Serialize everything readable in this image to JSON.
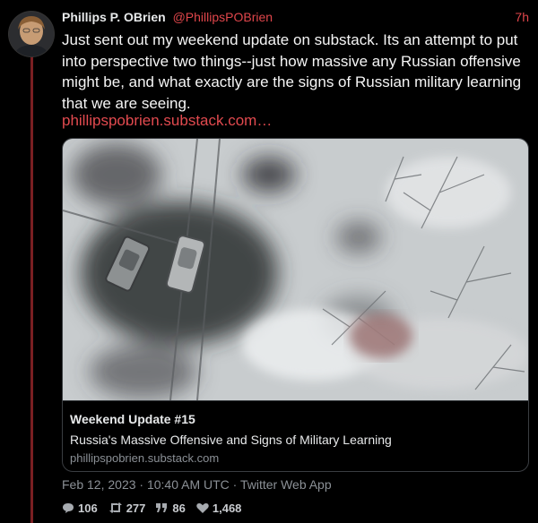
{
  "tweet": {
    "author_name": "Phillips P. OBrien",
    "author_handle": "@PhillipsPOBrien",
    "time_ago": "7h",
    "text": "Just sent out my weekend update on substack. Its an attempt to put into perspective two things--just how massive any Russian offensive might be, and what exactly are the signs of Russian military learning that we are seeing.",
    "link": "phillipspobrien.substack.com…",
    "timestamp": "Feb 12, 2023 · 10:40 AM UTC · Twitter Web App"
  },
  "card": {
    "title": "Weekend Update #15",
    "description": "Russia's Massive Offensive and Signs of Military Learning",
    "domain": "phillipspobrien.substack.com"
  },
  "stats": {
    "replies": "106",
    "retweets": "277",
    "quotes": "86",
    "likes": "1,468"
  },
  "icons": {
    "reply": "comment-icon",
    "retweet": "retweet-icon",
    "quote": "quote-icon",
    "like": "heart-icon"
  },
  "colors": {
    "accent": "#e0464b",
    "thread_line": "#7a1f22",
    "muted": "#8b9096"
  }
}
